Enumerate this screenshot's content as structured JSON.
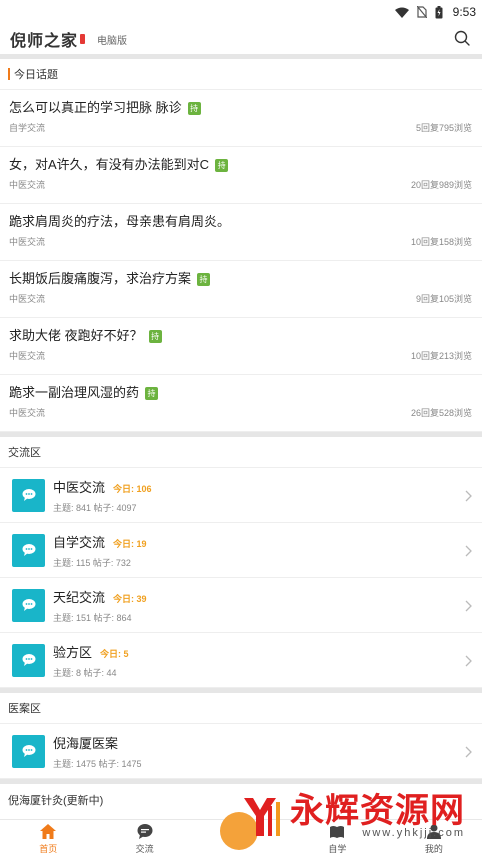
{
  "status_bar": {
    "time": "9:53"
  },
  "header": {
    "app_name": "倪师之家",
    "pc_link": "电脑版"
  },
  "today_section": {
    "title": "今日话题",
    "topics": [
      {
        "title": "怎么可以真正的学习把脉 脉诊",
        "tag": "持",
        "category": "自学交流",
        "stats": "5回复795浏览"
      },
      {
        "title": "女，对A许久，有没有办法能到对C",
        "tag": "持",
        "category": "中医交流",
        "stats": "20回复989浏览"
      },
      {
        "title": "跪求肩周炎的疗法，母亲患有肩周炎。",
        "tag": "",
        "category": "中医交流",
        "stats": "10回复158浏览"
      },
      {
        "title": "长期饭后腹痛腹泻，求治疗方案",
        "tag": "持",
        "category": "中医交流",
        "stats": "9回复105浏览"
      },
      {
        "title": "求助大佬 夜跑好不好？",
        "tag": "持",
        "category": "中医交流",
        "stats": "10回复213浏览"
      },
      {
        "title": "跪求一副治理风湿的药",
        "tag": "持",
        "category": "中医交流",
        "stats": "26回复528浏览"
      }
    ]
  },
  "exchange_section": {
    "title": "交流区",
    "forums": [
      {
        "name": "中医交流",
        "today": "今日: 106",
        "meta": "主题: 841  帖子: 4097"
      },
      {
        "name": "自学交流",
        "today": "今日: 19",
        "meta": "主题: 115  帖子: 732"
      },
      {
        "name": "天纪交流",
        "today": "今日: 39",
        "meta": "主题: 151  帖子: 864"
      },
      {
        "name": "验方区",
        "today": "今日: 5",
        "meta": "主题: 8  帖子: 44"
      }
    ]
  },
  "case_section": {
    "title": "医案区",
    "forums": [
      {
        "name": "倪海厦医案",
        "today": "",
        "meta": "主题: 1475  帖子: 1475"
      }
    ]
  },
  "acupuncture_section": {
    "title": "倪海厦针灸(更新中)"
  },
  "tabbar": {
    "home": "首页",
    "exchange": "交流",
    "self_study": "自学",
    "mine": "我的"
  },
  "watermark": {
    "text": "永辉资源网",
    "url": "www.yhkjjj.com"
  },
  "colors": {
    "accent": "#f07b1a",
    "forum_icon": "#19b5c9",
    "tag_green": "#6cb33f",
    "today_orange": "#f0a020"
  }
}
